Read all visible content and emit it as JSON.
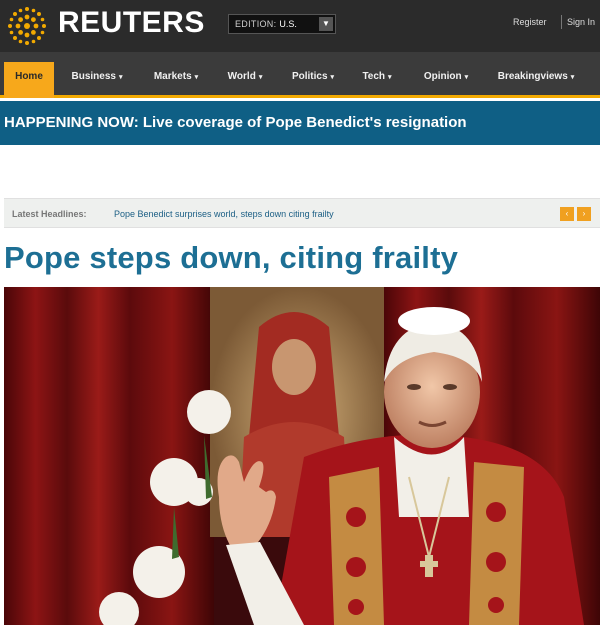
{
  "brand": {
    "name": "REUTERS",
    "colors": {
      "header_bg": "#2b2b2b",
      "accent": "#f7a81b",
      "banner": "#0f5f85",
      "headline": "#1d6f94"
    }
  },
  "header": {
    "edition_label": "EDITION:",
    "edition_value": "U.S.",
    "register": "Register",
    "sign_in": "Sign In"
  },
  "nav": {
    "items": [
      {
        "label": "Home",
        "active": true
      },
      {
        "label": "Business",
        "active": false
      },
      {
        "label": "Markets",
        "active": false
      },
      {
        "label": "World",
        "active": false
      },
      {
        "label": "Politics",
        "active": false
      },
      {
        "label": "Tech",
        "active": false
      },
      {
        "label": "Opinion",
        "active": false
      },
      {
        "label": "Breakingviews",
        "active": false
      }
    ],
    "caret": "▾"
  },
  "banner": {
    "text": "HAPPENING NOW: Live coverage of Pope Benedict's resignation"
  },
  "ticker": {
    "label": "Latest Headlines:",
    "headline": "Pope Benedict surprises world, steps down citing frailty",
    "prev": "‹",
    "next": "›"
  },
  "article": {
    "headline": "Pope steps down, citing frailty",
    "image_icon": "photo-of-pope-waving"
  }
}
